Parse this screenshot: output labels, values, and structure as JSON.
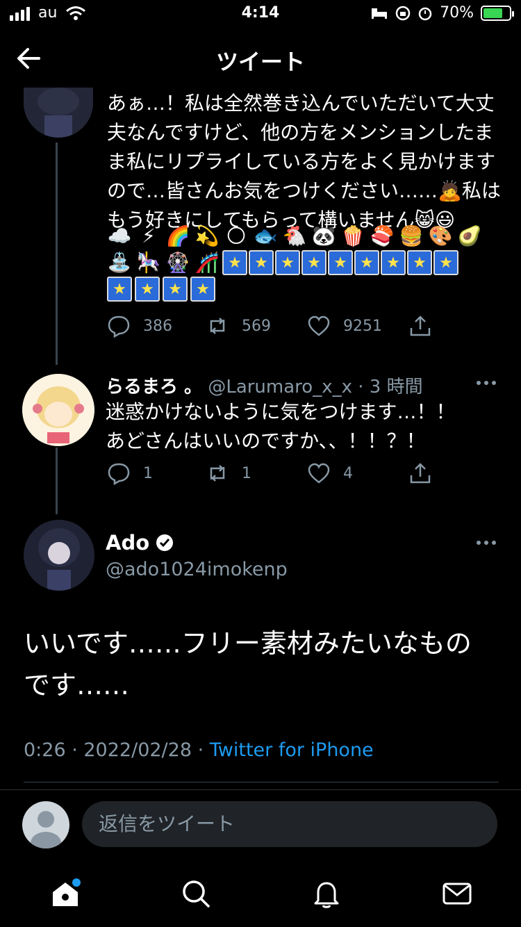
{
  "status_bar": {
    "carrier": "au",
    "time": "4:14",
    "battery": "70%"
  },
  "header": {
    "title": "ツイート"
  },
  "tweet1": {
    "lines": [
      "あぁ…！私は全然巻き込んでいただいて大丈",
      "夫なんですけど、他の方をメンションしたま",
      "ま私にリプライしている方をよく見かけます",
      "ので…皆さんお気をつけください……🙇私は",
      "もう好きにしてもらって構いません😸😃"
    ],
    "emoji_rows": [
      [
        "☁️",
        "⚡",
        "🌈",
        "💫",
        "🌕",
        "🐟",
        "🐔",
        "🐼",
        "🍿",
        "🍣",
        "🍔",
        "🎨",
        "🥑"
      ],
      [
        "⛲",
        "🎠",
        "🎡",
        "🎢"
      ]
    ],
    "reply_count": "386",
    "retweet_count": "569",
    "like_count": "9251"
  },
  "tweet2": {
    "name": "らるまろ 。",
    "handle": "@Larumaro_x_x",
    "time": "· 3 時間",
    "lines": [
      "迷惑かけないように気をつけます…！！",
      "あどさんはいいのですか、、！！？！"
    ],
    "reply_count": "1",
    "retweet_count": "1",
    "like_count": "4"
  },
  "main_tweet": {
    "name": "Ado",
    "handle": "@ado1024imokenp",
    "lines": [
      "いいです……フリー素材みたいなもの",
      "です……"
    ],
    "timestamp": "0:26 · 2022/02/28 · ",
    "source": "Twitter for iPhone"
  },
  "reply": {
    "placeholder": "返信をツイート"
  },
  "colors": {
    "accent": "#1d9bf0",
    "muted": "#8899a6",
    "verified": "#ffffff"
  }
}
